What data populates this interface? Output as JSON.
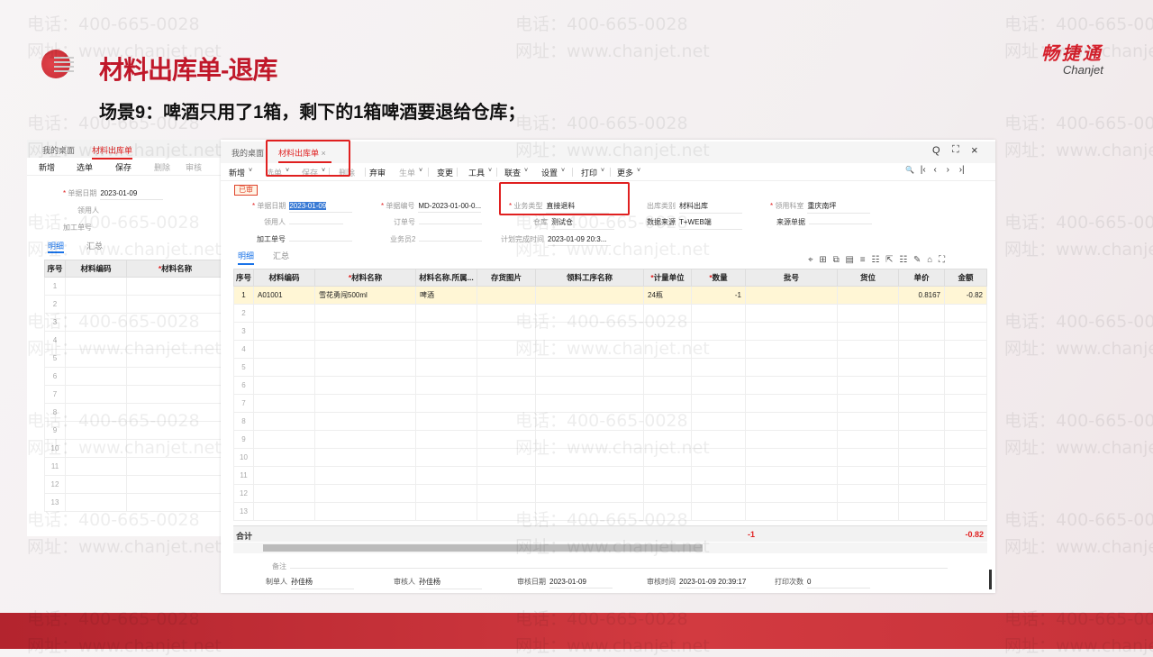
{
  "slide": {
    "title": "材料出库单-退库",
    "subtitle": "场景9：啤酒只用了1箱，剩下的1箱啤酒要退给仓库；",
    "brand_cn": "畅捷通",
    "brand_en": "Chanjet",
    "watermark_phone": "电话：400-665-0028",
    "watermark_url": "网址：www.chanjet.net"
  },
  "back_window": {
    "tabs": [
      "我的桌面",
      "材料出库单"
    ],
    "toolbar": [
      "新增",
      "选单",
      "保存",
      "删除",
      "审核"
    ],
    "fields": [
      {
        "label": "单据日期",
        "value": "2023-01-09"
      },
      {
        "label": "领用人",
        "value": ""
      },
      {
        "label": "加工单号",
        "value": ""
      }
    ],
    "subtabs": [
      "明细",
      "汇总"
    ],
    "columns": [
      "序号",
      "材料编码",
      "材料名称"
    ],
    "rows": [
      "1",
      "2",
      "3",
      "4",
      "5",
      "6",
      "7",
      "8",
      "9",
      "10",
      "11",
      "12",
      "13"
    ]
  },
  "window": {
    "tabs": {
      "home": "我的桌面",
      "active": "材料出库单",
      "close": "×"
    },
    "window_controls": {
      "search": "Q",
      "maximize": "⛶",
      "close": "×"
    },
    "toolbar": [
      {
        "label": "新增",
        "dd": "˅",
        "enabled": true
      },
      {
        "label": "选单",
        "dd": "˅",
        "enabled": false
      },
      {
        "label": "保存",
        "dd": "˅",
        "enabled": false
      },
      {
        "label": "删除",
        "enabled": false
      },
      {
        "label": "弃审",
        "enabled": true
      },
      {
        "label": "生单",
        "dd": "˅",
        "enabled": false
      },
      {
        "label": "变更",
        "enabled": true
      },
      {
        "label": "工具",
        "dd": "˅",
        "enabled": true
      },
      {
        "label": "联查",
        "dd": "˅",
        "enabled": true
      },
      {
        "label": "设置",
        "dd": "˅",
        "enabled": true
      },
      {
        "label": "打印",
        "dd": "˅",
        "enabled": true
      },
      {
        "label": "更多",
        "dd": "˅",
        "enabled": true
      }
    ],
    "nav": {
      "find": "🔍",
      "first": "|‹",
      "prev": "‹",
      "next": "›",
      "last": "›|"
    },
    "status_badge": "已审",
    "fields": {
      "date": {
        "label": "单据日期",
        "value": "2023-01-09"
      },
      "number": {
        "label": "单据编号",
        "value": "MD-2023-01-00-0..."
      },
      "biz_type": {
        "label": "业务类型",
        "value": "直接退料"
      },
      "out_type": {
        "label": "出库类别",
        "value": "材料出库"
      },
      "dept": {
        "label": "领用科室",
        "value": "重庆南坪"
      },
      "user": {
        "label": "领用人",
        "value": ""
      },
      "order": {
        "label": "订单号",
        "value": ""
      },
      "warehouse": {
        "label": "仓库",
        "value": "测试仓"
      },
      "source": {
        "label": "数据来源",
        "value": "T+WEB端"
      },
      "source_doc": {
        "label": "来源单据",
        "value": ""
      },
      "process_no": {
        "label": "加工单号",
        "value": ""
      },
      "clerk2": {
        "label": "业务员2",
        "value": ""
      },
      "plan_time": {
        "label": "计划完成时间",
        "value": "2023-01-09 20:3..."
      }
    },
    "subtabs": [
      "明细",
      "汇总"
    ],
    "columns": [
      "序号",
      "材料编码",
      "材料名称",
      "材料名称.所属...",
      "存货图片",
      "领料工序名称",
      "计量单位",
      "数量",
      "批号",
      "货位",
      "单价",
      "金额"
    ],
    "rows": [
      {
        "no": "1",
        "code": "A01001",
        "name": "雪花勇闯500ml",
        "category": "啤酒",
        "image": "",
        "process": "",
        "unit": "24瓶",
        "qty": "-1",
        "batch": "",
        "location": "",
        "price": "0.8167",
        "amount": "-0.82"
      }
    ],
    "empty_rows": [
      "2",
      "3",
      "4",
      "5",
      "6",
      "7",
      "8",
      "9",
      "10",
      "11",
      "12",
      "13"
    ],
    "total": {
      "label": "合计",
      "qty": "-1",
      "amount": "-0.82"
    },
    "remark": {
      "label": "备注",
      "value": ""
    },
    "footer": [
      {
        "label": "制单人",
        "value": "孙佳杨"
      },
      {
        "label": "审核人",
        "value": "孙佳杨"
      },
      {
        "label": "审核日期",
        "value": "2023-01-09"
      },
      {
        "label": "审核时间",
        "value": "2023-01-09 20:39:17"
      },
      {
        "label": "打印次数",
        "value": "0"
      }
    ]
  }
}
